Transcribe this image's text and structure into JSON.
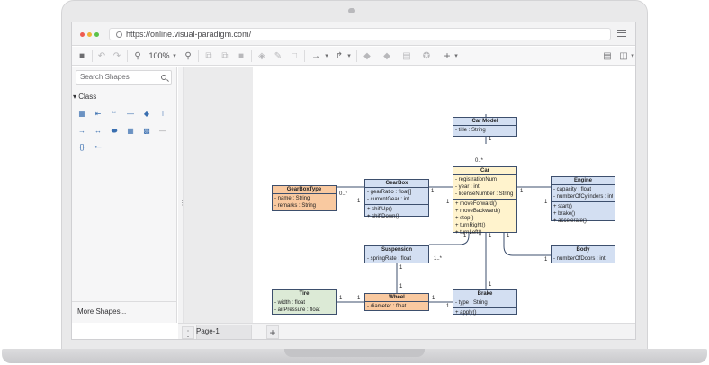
{
  "browser": {
    "url": "https://online.visual-paradigm.com/"
  },
  "toolbar": {
    "zoom": "100%"
  },
  "sidebar": {
    "search_placeholder": "Search Shapes",
    "section_title": "Class",
    "more_shapes": "More Shapes..."
  },
  "pages": {
    "tab_label": "Page-1"
  },
  "diagram": {
    "car_model": {
      "name": "Car Model",
      "attributes": [
        "- title : String"
      ]
    },
    "car": {
      "name": "Car",
      "attributes": [
        "- registrationNum",
        "- year : int",
        "- licenseNumber : String"
      ],
      "operations": [
        "+ moveForward()",
        "+ moveBackward()",
        "+ stop()",
        "+ turnRight()",
        "+ turnLeft()"
      ]
    },
    "engine": {
      "name": "Engine",
      "attributes": [
        "- capacity : float",
        "- numberOfCylinders : int"
      ],
      "operations": [
        "+ start()",
        "+ brake()",
        "+ accelerate()"
      ]
    },
    "gearbox": {
      "name": "GearBox",
      "attributes": [
        "- gearRatio : float[]",
        "- currentGear : int"
      ],
      "operations": [
        "+ shiftUp()",
        "+ shiftDown()"
      ]
    },
    "gearbox_type": {
      "name": "GearBoxType",
      "attributes": [
        "- name : String",
        "- remarks : String"
      ]
    },
    "suspension": {
      "name": "Suspension",
      "attributes": [
        "- springRate : float"
      ]
    },
    "body": {
      "name": "Body",
      "attributes": [
        "- numberOfDoors : int"
      ]
    },
    "tire": {
      "name": "Tire",
      "attributes": [
        "- width : float",
        "- airPressure : float"
      ]
    },
    "wheel": {
      "name": "Wheel",
      "attributes": [
        "- diameter : float"
      ]
    },
    "brake": {
      "name": "Brake",
      "attributes": [
        "- type : String"
      ],
      "operations": [
        "+ apply()"
      ]
    },
    "multiplicities": {
      "model_top": "1",
      "car_top": "0..*",
      "gbt_right": "0..*",
      "gb_left": "1",
      "gb_right": "1",
      "car_left": "1",
      "car_right": "1",
      "engine_left": "1",
      "car_bottom_left": "1",
      "susp_right": "1..*",
      "car_bottom_right": "1",
      "body_left": "1",
      "susp_bottom": "1",
      "wheel_top": "1",
      "car_bottom_mid": "1",
      "brake_top": "1",
      "tire_right": "1",
      "wheel_left": "1",
      "wheel_right": "1",
      "brake_left": "1"
    }
  }
}
